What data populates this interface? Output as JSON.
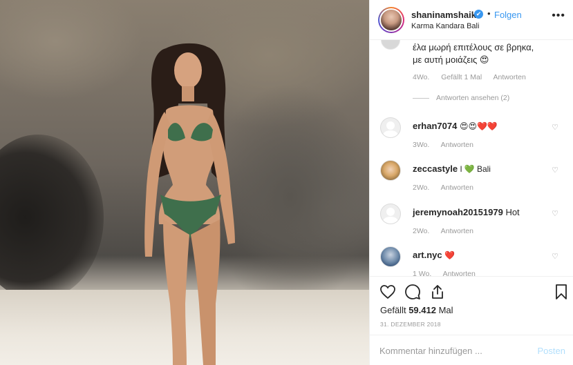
{
  "header": {
    "username": "shaninamshaik",
    "verified_badge": "✔",
    "separator": "•",
    "follow_label": "Folgen",
    "location": "Karma Kandara Bali",
    "more_icon": "more-icon"
  },
  "first_comment": {
    "text_line1": "έλα μωρή επιτέλους σε βρηκα,",
    "text_line2": "με αυτή μοιάζεις 😍",
    "time": "4Wo.",
    "likes": "Gefällt 1 Mal",
    "reply": "Antworten",
    "view_replies": "Antworten ansehen (2)"
  },
  "comments": [
    {
      "user": "erhan7074",
      "text": "😍😍❤️❤️",
      "time": "3Wo.",
      "reply": "Antworten"
    },
    {
      "user": "zeccastyle",
      "text": "l 💚 Bali",
      "time": "2Wo.",
      "reply": "Antworten"
    },
    {
      "user": "jeremynoah20151979",
      "text": "Hot",
      "time": "2Wo.",
      "reply": "Antworten"
    },
    {
      "user": "art.nyc",
      "text": "❤️",
      "time": "1 Wo.",
      "reply": "Antworten"
    }
  ],
  "actions": {
    "likes_prefix": "Gefällt",
    "likes_count": "59.412",
    "likes_suffix": "Mal",
    "date": "31. DEZEMBER 2018"
  },
  "add_comment": {
    "placeholder": "Kommentar hinzufügen ...",
    "post_label": "Posten"
  },
  "colors": {
    "accent": "#3897f0",
    "post_disabled": "#b2dffc",
    "muted": "#999999"
  }
}
